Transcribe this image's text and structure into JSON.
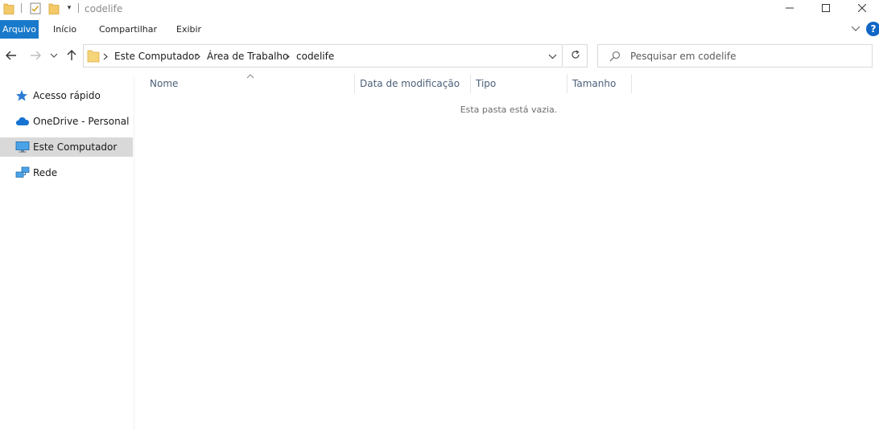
{
  "window": {
    "title": "codelife",
    "qat_dropdown_glyph": "▾",
    "controls": {
      "minimize_icon": "minimize-icon",
      "maximize_icon": "maximize-icon",
      "close_icon": "close-icon"
    }
  },
  "ribbon": {
    "tabs": [
      {
        "label": "Arquivo"
      },
      {
        "label": "Início"
      },
      {
        "label": "Compartilhar"
      },
      {
        "label": "Exibir"
      }
    ],
    "help_glyph": "?",
    "accent": "#1979ca"
  },
  "navigation": {
    "breadcrumb": [
      "Este Computador",
      "Área de Trabalho",
      "codelife"
    ]
  },
  "search": {
    "placeholder": "Pesquisar em codelife",
    "value": ""
  },
  "sidebar": {
    "items": [
      {
        "label": "Acesso rápido",
        "icon": "star-icon",
        "selected": false
      },
      {
        "label": "OneDrive - Personal",
        "icon": "cloud-icon",
        "selected": false
      },
      {
        "label": "Este Computador",
        "icon": "computer-icon",
        "selected": true
      },
      {
        "label": "Rede",
        "icon": "network-icon",
        "selected": false
      }
    ]
  },
  "file_list": {
    "columns": [
      {
        "label": "Nome"
      },
      {
        "label": "Data de modificação"
      },
      {
        "label": "Tipo"
      },
      {
        "label": "Tamanho"
      }
    ],
    "sorted_column": "Nome",
    "empty_message": "Esta pasta está vazia.",
    "rows": []
  }
}
